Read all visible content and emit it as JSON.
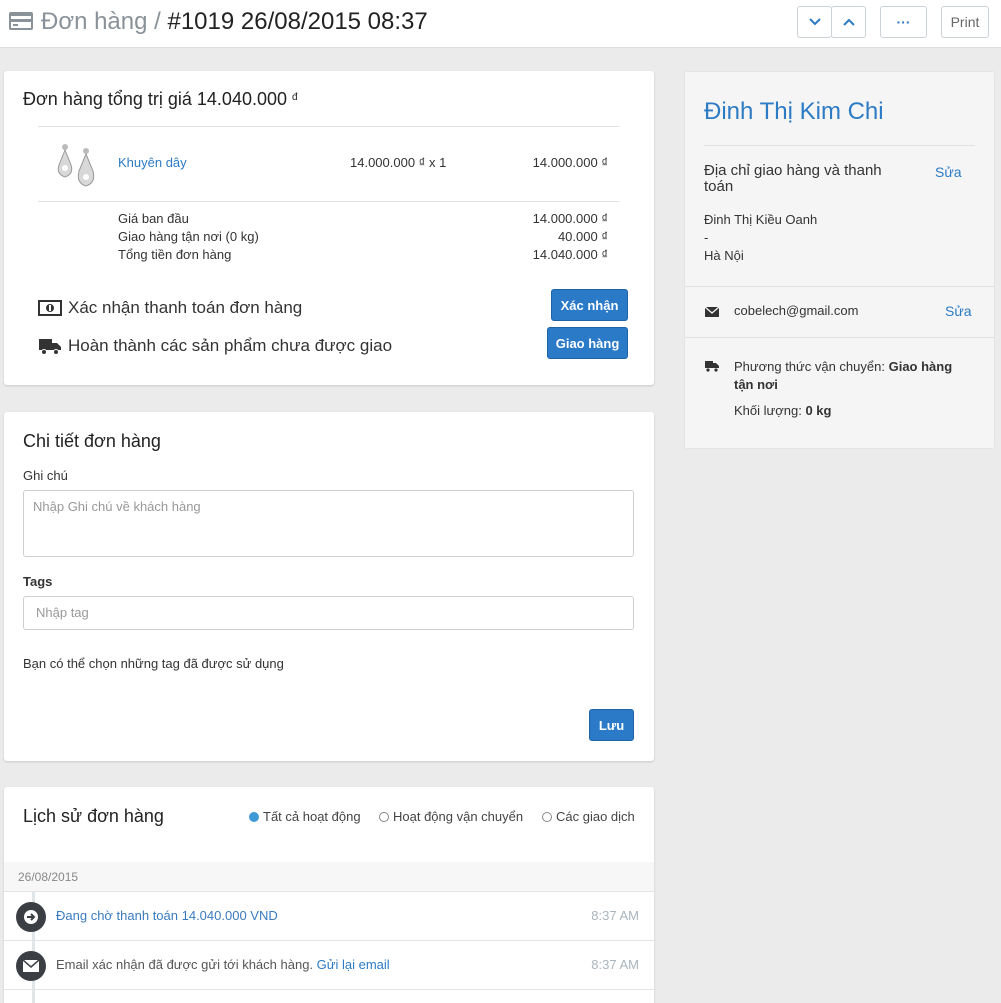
{
  "header": {
    "crumb": "Đơn hàng /",
    "title": "#1019 26/08/2015 08:37",
    "down_icon": "chevron-down-icon",
    "up_icon": "chevron-up-icon",
    "more_label": "···",
    "print_label": "Print"
  },
  "summary": {
    "heading": "Đơn hàng tổng trị giá 14.040.000",
    "currency": "đ",
    "item": {
      "name": "Khuyên dây",
      "qty": "14.000.000 ₫ x 1",
      "total": "14.000.000 ₫"
    },
    "rows": [
      {
        "label": "Giá ban đầu",
        "value": "14.000.000 ₫"
      },
      {
        "label": "Giao hàng tận nơi (0 kg)",
        "value": "40.000 ₫"
      },
      {
        "label": "Tổng tiền đơn hàng",
        "value": "14.040.000 ₫"
      }
    ],
    "payment_text": "Xác nhận thanh toán đơn hàng",
    "payment_button": "Xác nhận",
    "fulfill_text": "Hoàn thành các sản phẩm chưa được giao",
    "fulfill_button": "Giao hàng"
  },
  "details": {
    "heading": "Chi tiết đơn hàng",
    "note_label": "Ghi chú",
    "note_placeholder": "Nhập Ghi chú về khách hàng",
    "tags_label": "Tags",
    "tags_placeholder": "Nhập tag",
    "hint": "Bạn có thể chọn những tag đã được sử dụng",
    "save_button": "Lưu"
  },
  "history": {
    "heading": "Lịch sử đơn hàng",
    "filters": [
      "Tất cả hoạt động",
      "Hoạt động vận chuyển",
      "Các giao dịch"
    ],
    "date": "26/08/2015",
    "events": [
      {
        "text": "Đang chờ thanh toán 14.040.000 VND",
        "time": "8:37 AM"
      },
      {
        "text": "Email xác nhận đã được gửi tới khách hàng.",
        "link": "Gửi lại email",
        "time": "8:37 AM"
      }
    ]
  },
  "customer": {
    "name": "Đinh Thị Kim Chi",
    "address_title": "Địa chỉ giao hàng và thanh toán",
    "edit_label": "Sửa",
    "address_lines": [
      "Đinh Thị Kiều Oanh",
      "-",
      "Hà Nội"
    ],
    "email": "cobelech@gmail.com",
    "shipping_label": "Phương thức vận chuyển:",
    "shipping_value": "Giao hàng tận nơi",
    "weight_label": "Khối lượng:",
    "weight_value": "0 kg"
  },
  "colors": {
    "accent": "#2a7ac7",
    "link": "#2c7bc4",
    "background": "#ebebeb"
  }
}
